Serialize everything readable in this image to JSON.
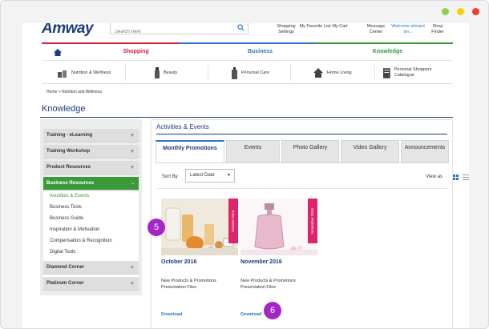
{
  "window": {
    "controls": [
      "green",
      "yellow",
      "red"
    ]
  },
  "header": {
    "logo": "Amway",
    "search_placeholder": "Search here",
    "links": [
      {
        "label": "Shopping Settings"
      },
      {
        "label": "My Favorite List"
      },
      {
        "label": "My Cart"
      },
      {
        "label": "Message Center"
      },
      {
        "label": "Welcome shivani sin..."
      },
      {
        "label": "Shop Finder"
      }
    ]
  },
  "colors": {
    "red": "#d6203a",
    "blue": "#2a74c9",
    "green": "#3a9a3a",
    "navy": "#1d3c7a",
    "pink": "#e0246b"
  },
  "mainnav": {
    "home_icon": "home-icon",
    "items": [
      {
        "label": "Shopping",
        "color": "#d6203a"
      },
      {
        "label": "Business",
        "color": "#2a74c9"
      },
      {
        "label": "Knowledge",
        "color": "#3a9a3a"
      }
    ]
  },
  "subnav": {
    "items": [
      {
        "label": "Nutrition & Wellness"
      },
      {
        "label": "Beauty"
      },
      {
        "label": "Personal Care"
      },
      {
        "label": "Home Living"
      },
      {
        "label": "Personal Shoppers Catalogue"
      }
    ]
  },
  "breadcrumb": "Home  >  Nutrition and Wellness",
  "page_title": "Knowledge",
  "sidebar": {
    "items": [
      {
        "label": "Training - eLearning",
        "expand": "+"
      },
      {
        "label": "Training Workshop",
        "expand": "+"
      },
      {
        "label": "Product Resources",
        "expand": "+"
      },
      {
        "label": "Business Resources",
        "expand": "-"
      },
      {
        "label": "Diamond Corner",
        "expand": "+"
      },
      {
        "label": "Platinum Corner",
        "expand": "+"
      }
    ],
    "subitems": [
      {
        "label": "Activities & Events"
      },
      {
        "label": "Business Tools"
      },
      {
        "label": "Business Guide"
      },
      {
        "label": "Inspiration & Motivation"
      },
      {
        "label": "Compensation & Recognition"
      },
      {
        "label": "Digital Tools"
      }
    ]
  },
  "content": {
    "title": "Activities & Events",
    "tabs": [
      {
        "label": "Monthly Promotions"
      },
      {
        "label": "Events"
      },
      {
        "label": "Photo Gallery"
      },
      {
        "label": "Video Gallery"
      },
      {
        "label": "Announcements"
      }
    ],
    "sort_label": "Sort By",
    "sort_value": "Latest Date",
    "view_label": "View as",
    "cards": [
      {
        "ribbon": "October 2016",
        "title": "October 2016",
        "desc": "New Products & Promotions Presentation Files",
        "download": "Download"
      },
      {
        "ribbon": "November 2016",
        "title": "November 2016",
        "desc": "New Products & Promotions Presentation Files",
        "download": "Download"
      }
    ]
  },
  "markers": [
    "5",
    "6"
  ]
}
